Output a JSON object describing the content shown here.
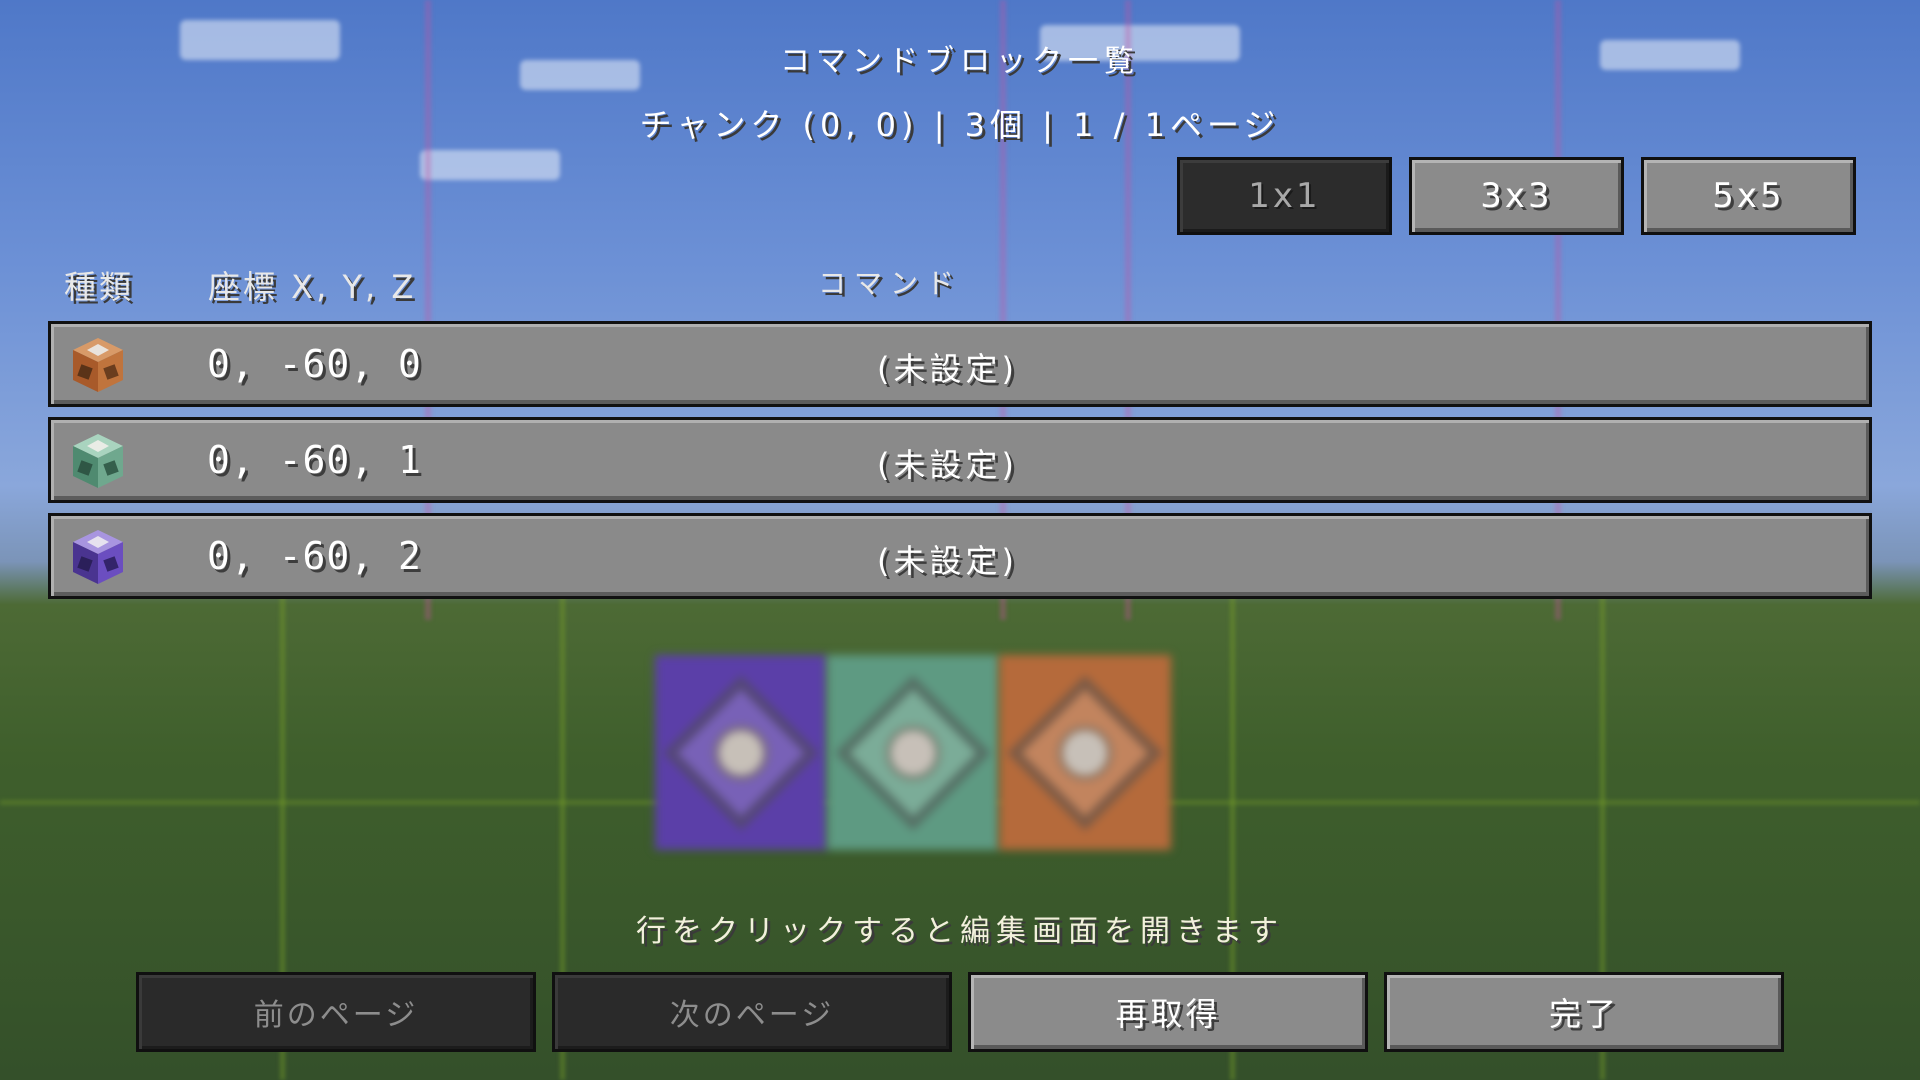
{
  "header": {
    "title": "コマンドブロック一覧",
    "subtitle": "チャンク (0, 0) | 3個 | 1 / 1ページ"
  },
  "area_buttons": {
    "one": "1x1",
    "three": "3x3",
    "five": "5x5",
    "selected": "1x1"
  },
  "columns": {
    "type": "種類",
    "coords": "座標 X, Y, Z",
    "command": "コマンド"
  },
  "rows": [
    {
      "block_type": "impulse",
      "color": "#c0743d",
      "coords": "0, -60, 0",
      "command": "(未設定)"
    },
    {
      "block_type": "chain",
      "color": "#6fa88e",
      "coords": "0, -60, 1",
      "command": "(未設定)"
    },
    {
      "block_type": "repeat",
      "color": "#6b4ec0",
      "coords": "0, -60, 2",
      "command": "(未設定)"
    }
  ],
  "hint": "行をクリックすると編集画面を開きます",
  "footer": {
    "prev": "前のページ",
    "next": "次のページ",
    "reload": "再取得",
    "done": "完了"
  }
}
